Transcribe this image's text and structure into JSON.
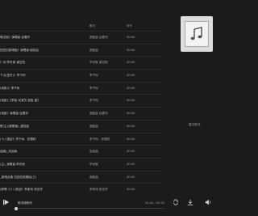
{
  "header": {
    "artist_label": "歌手",
    "duration_label": "时长"
  },
  "tracks": [
    {
      "title": "概念版》演唱者:谷着邓",
      "artist": "谢桂曲 谷着邓",
      "duration": "00:00"
    },
    {
      "title": "四四四原唱版》演唱者:谢桂曲",
      "artist": "谢桂曲",
      "duration": "00:00"
    },
    {
      "title": "》对:李世家 谢志阳",
      "artist": "李世家 谢志阳",
      "duration": "00:00"
    },
    {
      "title": "下山(竖竹)》李子树",
      "artist": "李子树",
      "duration": "00:00"
    },
    {
      "title": "(电影)》李子树",
      "artist": "李子树",
      "duration": "00:00"
    },
    {
      "title": "(电影》【李板 戏演员 谢板 谢】",
      "artist": "李子树",
      "duration": "00:00"
    },
    {
      "title": "(电影》演唱者:谷着邓",
      "artist": "谢桂曲 谷着邓",
      "duration": "00:00"
    },
    {
      "title": "歌(主)(副歌版)_谢桂曲",
      "artist": "谢桂曲",
      "duration": "00:00"
    },
    {
      "title": "(十八般武》李子树、张德林",
      "artist": "李子树、张德林",
      "duration": "00:00"
    },
    {
      "title": "曲版)_戏曲版",
      "artist": "张桂曲",
      "duration": "00:00"
    },
    {
      "title": "(主)_演唱者:李世家",
      "artist": "李世家",
      "duration": "00:00"
    },
    {
      "title": "_原唱全集 四四四原唱版(王)",
      "artist": "谢桂曲",
      "duration": "00:00"
    },
    {
      "title": "(原唱《十八般武》李家戏 张世学",
      "artist": "李家戏 张世学",
      "duration": "00:00"
    },
    {
      "title": "(主)(合唱)》 )\"上九个啥 最高 心\" 谷着邓",
      "artist": "谷着邓",
      "duration": "00:00"
    }
  ],
  "side": {
    "no_lyrics": "暂无歌词"
  },
  "player": {
    "now_title": "歌词请聆听",
    "time": "00:00 / 00:00",
    "progress": 0
  },
  "icons": {
    "play": "play-icon",
    "loop": "loop-icon",
    "download": "download-icon",
    "volume": "volume-icon",
    "cover": "music-note-icon"
  }
}
